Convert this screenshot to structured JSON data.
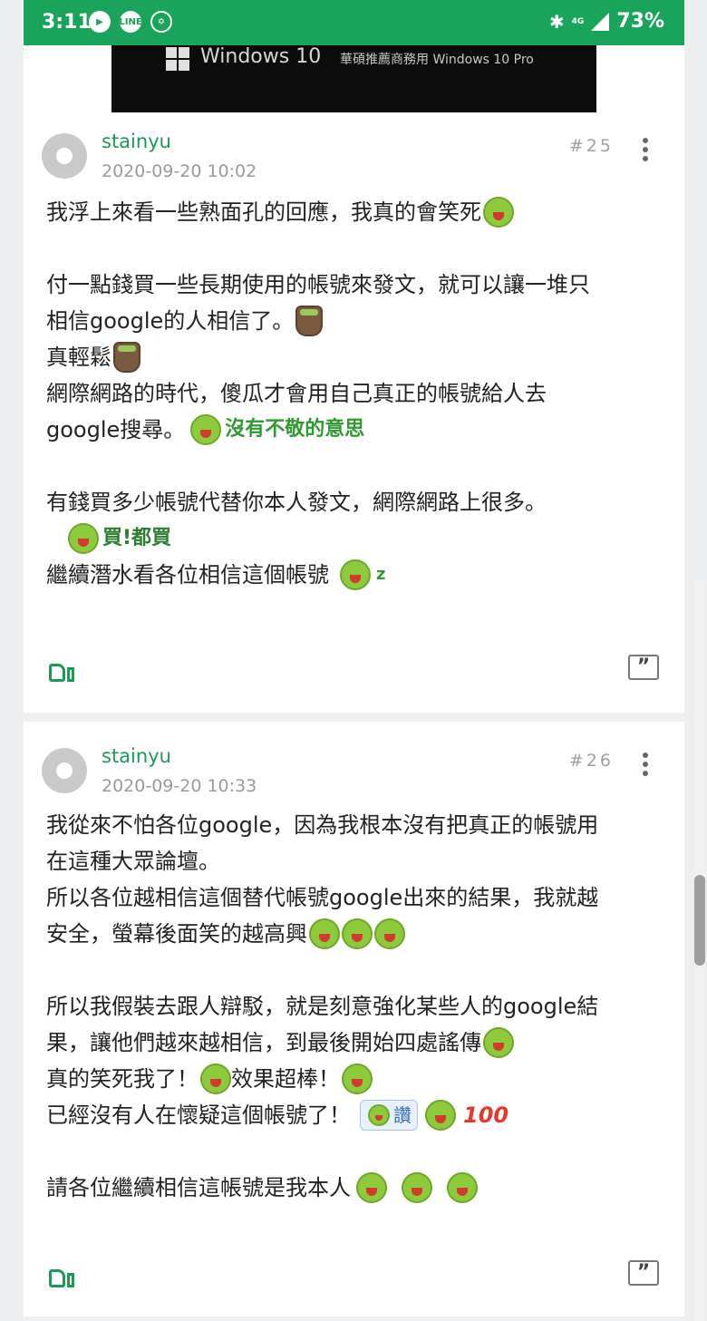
{
  "status_bar": {
    "time": "3:11",
    "network": "4G",
    "battery": "73%"
  },
  "banner": {
    "title": "Windows 10",
    "subtitle": "華碩推薦商務用 Windows 10 Pro"
  },
  "posts": [
    {
      "author": "stainyu",
      "time": "2020-09-20 10:02",
      "floor": "#25",
      "lines": {
        "l1": "我浮上來看一些熟面孔的回應，我真的會笑死",
        "l2": "付一點錢買一些長期使用的帳號來發文，就可以讓一堆只",
        "l3": "相信google的人相信了。",
        "l4": "真輕鬆",
        "l5": "網際網路的時代，傻瓜才會用自己真正的帳號給人去",
        "l6": "google搜尋。",
        "l6_sticker": "沒有不敬的意思",
        "l7": "有錢買多少帳號代替你本人發文，網際網路上很多。",
        "l8_sticker": "買!都買",
        "l9": "繼續潛水看各位相信這個帳號",
        "l9_z": "z"
      }
    },
    {
      "author": "stainyu",
      "time": "2020-09-20 10:33",
      "floor": "#26",
      "lines": {
        "l1": "我從來不怕各位google，因為我根本沒有把真正的帳號用",
        "l2": "在這種大眾論壇。",
        "l3": "所以各位越相信這個替代帳號google出來的結果，我就越",
        "l4": "安全，螢幕後面笑的越高興",
        "l5": "所以我假裝去跟人辯駁，就是刻意強化某些人的google結",
        "l6": "果，讓他們越來越相信，到最後開始四處謠傳",
        "l7a": "真的笑死我了！",
        "l7b": "效果超棒！",
        "l8": "已經沒有人在懷疑這個帳號了！",
        "l8_badge": "讚",
        "l8_100": "100",
        "l9": "請各位繼續相信這帳號是我本人"
      }
    }
  ],
  "icons": {
    "like": "thumbs-up-icon",
    "quote": "quote-icon",
    "more": "more-vertical-icon"
  },
  "colors": {
    "accent": "#1a9a55",
    "status_bar": "#1aa35a"
  }
}
